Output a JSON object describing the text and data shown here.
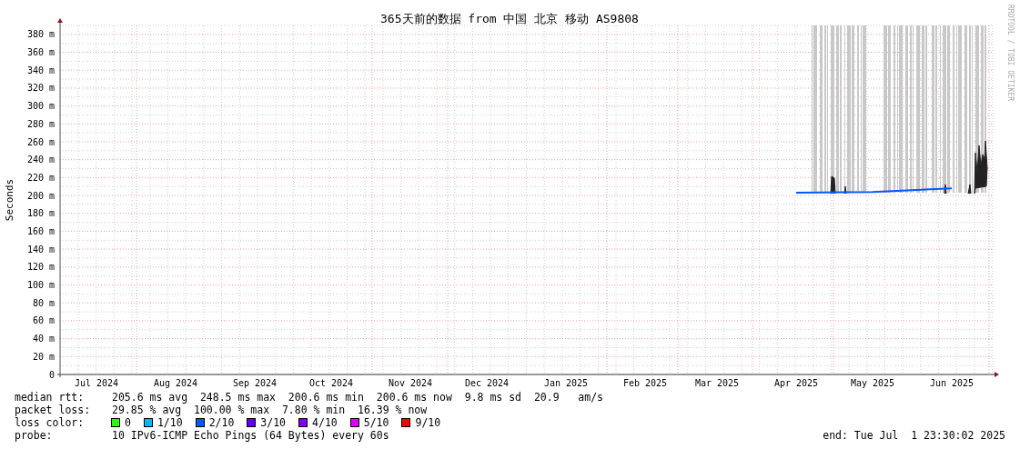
{
  "chart": {
    "chart_data": {
      "type": "line",
      "title": "365天前的数据 from 中国 北京 移动 AS9808",
      "ylabel": "Seconds",
      "categories": [
        "Jul 2024",
        "Aug 2024",
        "Sep 2024",
        "Oct 2024",
        "Nov 2024",
        "Dec 2024",
        "Jan 2025",
        "Feb 2025",
        "Mar 2025",
        "Apr 2025",
        "May 2025",
        "Jun 2025"
      ],
      "grid": true,
      "series": [
        {
          "color": "#0059ff",
          "values": [
            null,
            null,
            null,
            null,
            null,
            null,
            null,
            null,
            null,
            203,
            204,
            208
          ]
        }
      ],
      "ylim": [
        0,
        390
      ],
      "yticks": [
        {
          "value": 0,
          "label": "0"
        },
        {
          "value": 20,
          "label": "20 m"
        },
        {
          "value": 40,
          "label": "40 m"
        },
        {
          "value": 60,
          "label": "60 m"
        },
        {
          "value": 80,
          "label": "80 m"
        },
        {
          "value": 100,
          "label": "100 m"
        },
        {
          "value": 120,
          "label": "120 m"
        },
        {
          "value": 140,
          "label": "140 m"
        },
        {
          "value": 160,
          "label": "160 m"
        },
        {
          "value": 180,
          "label": "180 m"
        },
        {
          "value": 200,
          "label": "200 m"
        },
        {
          "value": 220,
          "label": "220 m"
        },
        {
          "value": 240,
          "label": "240 m"
        },
        {
          "value": 260,
          "label": "260 m"
        },
        {
          "value": 280,
          "label": "280 m"
        },
        {
          "value": 300,
          "label": "300 m"
        },
        {
          "value": 320,
          "label": "320 m"
        },
        {
          "value": 340,
          "label": "340 m"
        },
        {
          "value": 360,
          "label": "360 m"
        },
        {
          "value": 380,
          "label": "380 m"
        }
      ]
    },
    "credit": "RRDTOOL / TOBI OETIKER"
  },
  "stats": [
    {
      "label": "median rtt:",
      "value": "205.6 ms avg  248.5 ms max  200.6 ms min  200.6 ms now  9.8 ms sd  20.9   am/s"
    },
    {
      "label": "packet loss:",
      "value": "29.85 % avg  100.00 % max  7.80 % min  16.39 % now"
    }
  ],
  "loss_color": {
    "label": "loss color:",
    "items": [
      {
        "label": "0",
        "color": "#26ff00"
      },
      {
        "label": "1/10",
        "color": "#00b8ff"
      },
      {
        "label": "2/10",
        "color": "#0059ff"
      },
      {
        "label": "3/10",
        "color": "#5e00ff"
      },
      {
        "label": "4/10",
        "color": "#7e00ff"
      },
      {
        "label": "5/10",
        "color": "#dd00ff"
      },
      {
        "label": "9/10",
        "color": "#ff0000"
      }
    ]
  },
  "probe": {
    "label": "probe:",
    "value": "10 IPv6-ICMP Echo Pings (64 Bytes) every 60s"
  },
  "end": "end: Tue Jul  1 23:30:02 2025"
}
